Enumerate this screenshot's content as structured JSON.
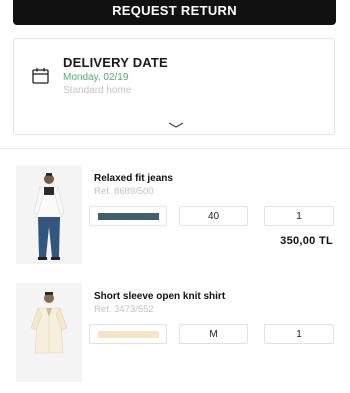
{
  "header": {
    "return_button_label": "REQUEST RETURN"
  },
  "delivery": {
    "title": "DELIVERY DATE",
    "date": "Monday, 02/19",
    "method": "Standard home",
    "date_color": "#4caf73",
    "icon": "calendar-icon",
    "expand_icon": "chevron-down-icon"
  },
  "products": [
    {
      "name": "Relaxed fit jeans",
      "ref": "Ref.  8689/500",
      "color_swatch": "#3e5f6b",
      "size": "40",
      "quantity": "1",
      "price": "350,00 TL"
    },
    {
      "name": "Short sleeve open knit shirt",
      "ref": "Ref.  3473/552",
      "color_swatch": "#f3e6c8",
      "size": "M",
      "quantity": "1"
    }
  ]
}
